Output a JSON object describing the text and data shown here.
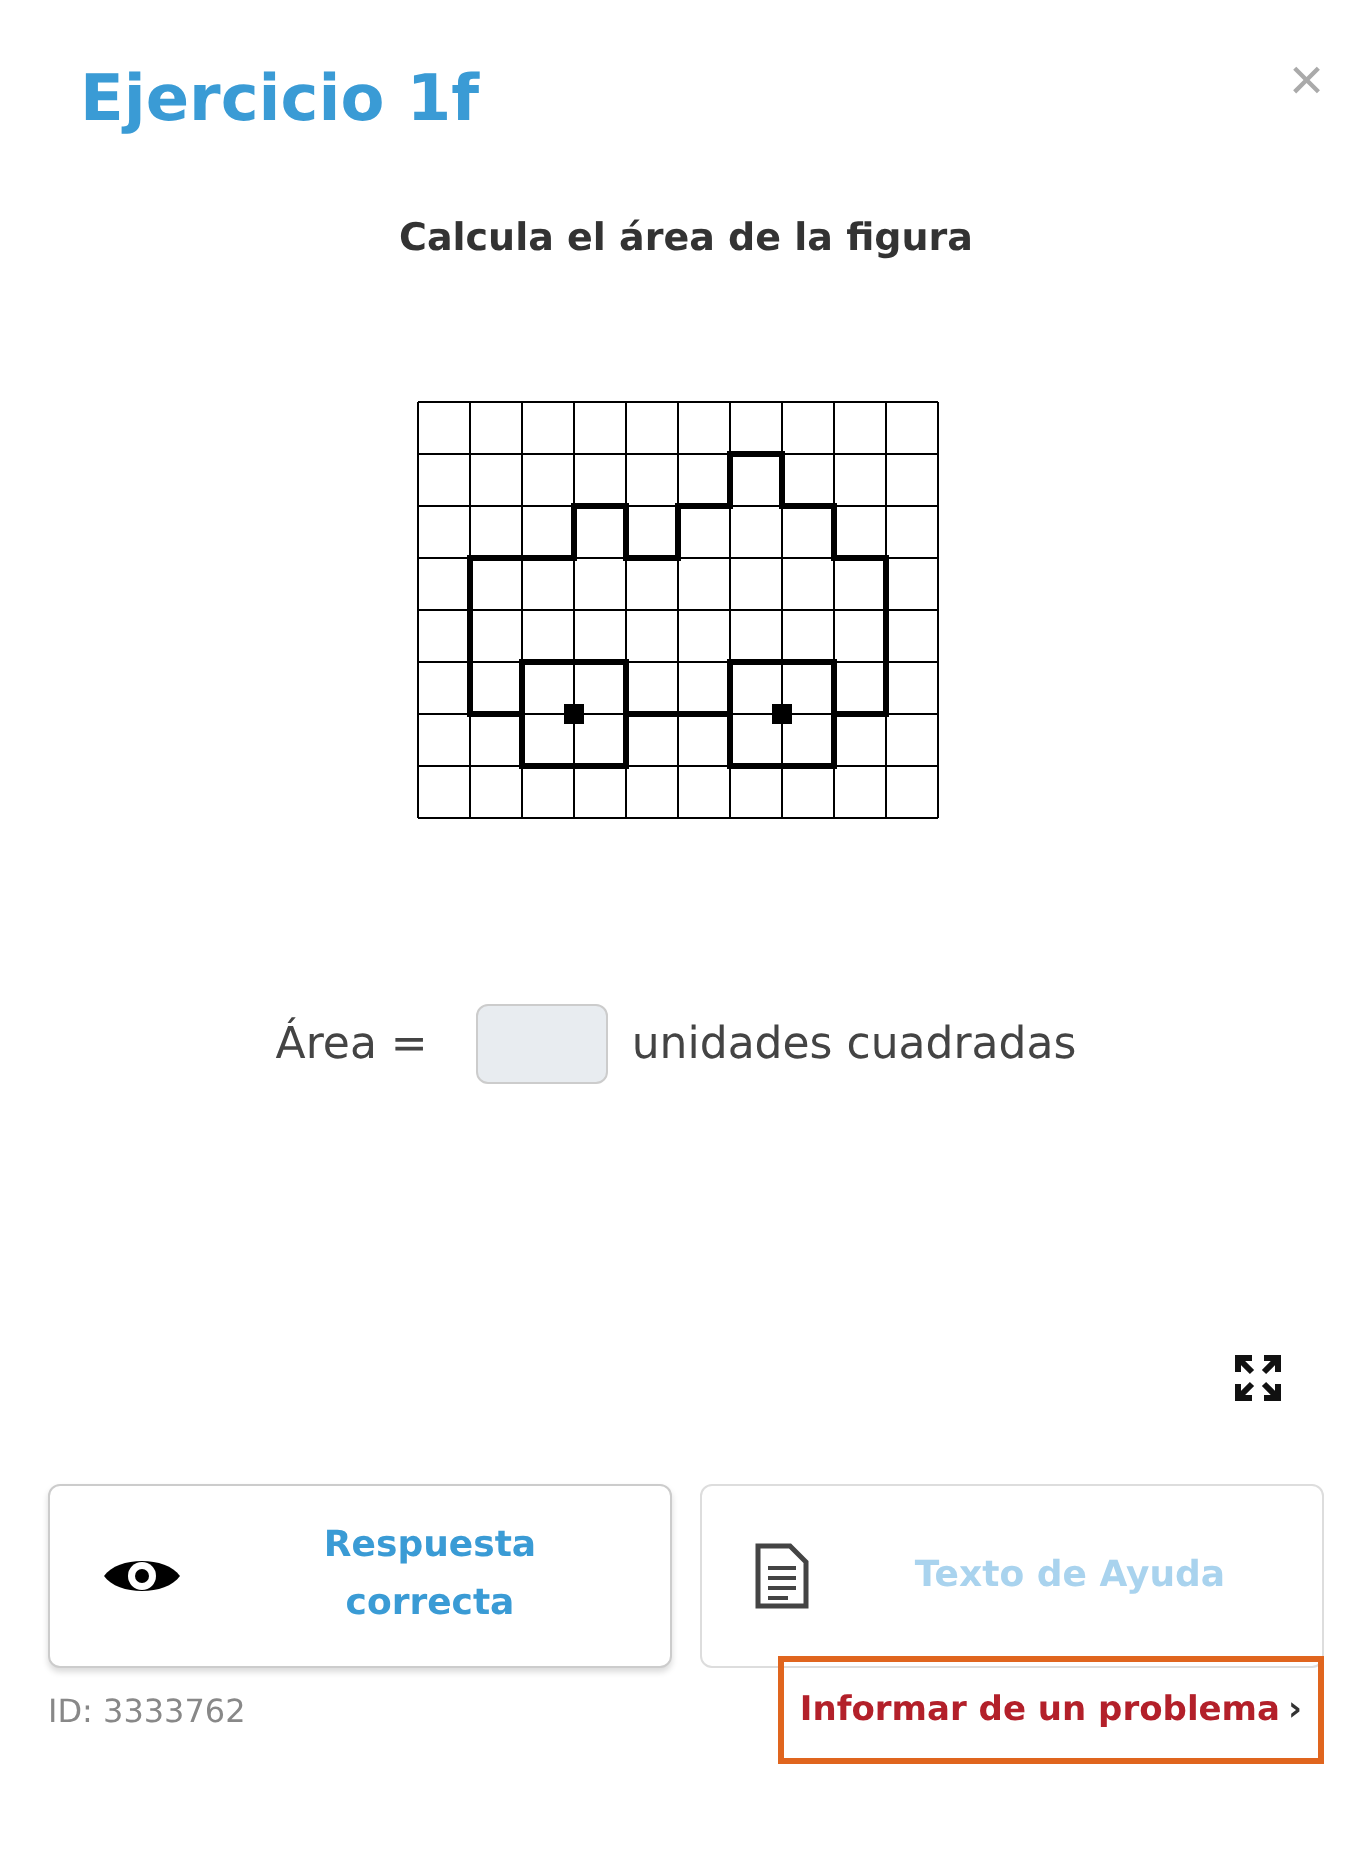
{
  "title": "Ejercicio 1f",
  "close": "×",
  "prompt": "Calcula el área de la figura",
  "answer": {
    "label": "Área =",
    "unit": "unidades cuadradas"
  },
  "buttons": [
    {
      "kind": "answer",
      "label": "Respuesta correcta",
      "disabled": false
    },
    {
      "kind": "help",
      "label": "Texto de Ayuda",
      "disabled": true
    }
  ],
  "id_text": "ID: 3333762",
  "report": {
    "label": "Informar de un problema",
    "arrow": "›",
    "highlighted": true
  }
}
